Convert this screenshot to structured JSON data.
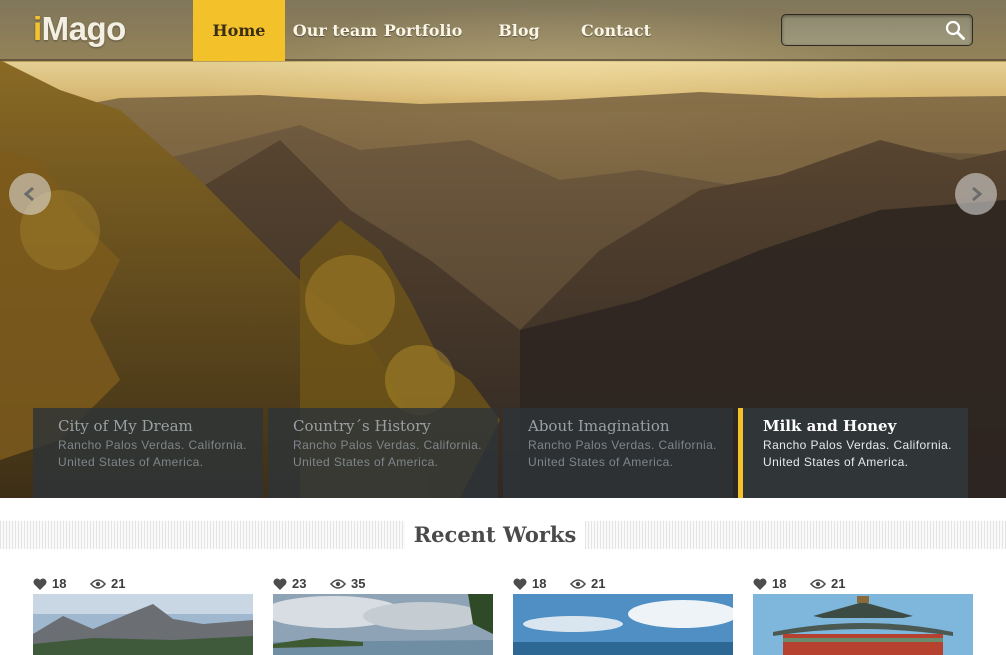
{
  "header": {
    "logo": {
      "prefix": "i",
      "rest": "Mago"
    },
    "nav": [
      {
        "label": "Home",
        "active": true
      },
      {
        "label": "Our team",
        "active": false
      },
      {
        "label": "Portfolio",
        "active": false
      },
      {
        "label": "Blog",
        "active": false
      },
      {
        "label": "Contact",
        "active": false
      }
    ],
    "search": {
      "value": "",
      "placeholder": ""
    }
  },
  "slider": {
    "captions": [
      {
        "title": "City of My Dream",
        "desc": "Rancho Palos Verdas. California. United States of America.",
        "active": false
      },
      {
        "title": "Country´s History",
        "desc": "Rancho Palos Verdas. California. United States of America.",
        "active": false
      },
      {
        "title": "About Imagination",
        "desc": "Rancho Palos Verdas. California. United States of America.",
        "active": false
      },
      {
        "title": "Milk and Honey",
        "desc": "Rancho Palos Verdas. California. United States of America.",
        "active": true
      }
    ]
  },
  "recent_works": {
    "title": "Recent Works",
    "items": [
      {
        "likes": "18",
        "views": "21"
      },
      {
        "likes": "23",
        "views": "35"
      },
      {
        "likes": "18",
        "views": "21"
      },
      {
        "likes": "18",
        "views": "21"
      }
    ]
  },
  "colors": {
    "accent": "#f3c22b",
    "caption_bg": "#2e3438",
    "text_dark": "#4a4a4a"
  }
}
